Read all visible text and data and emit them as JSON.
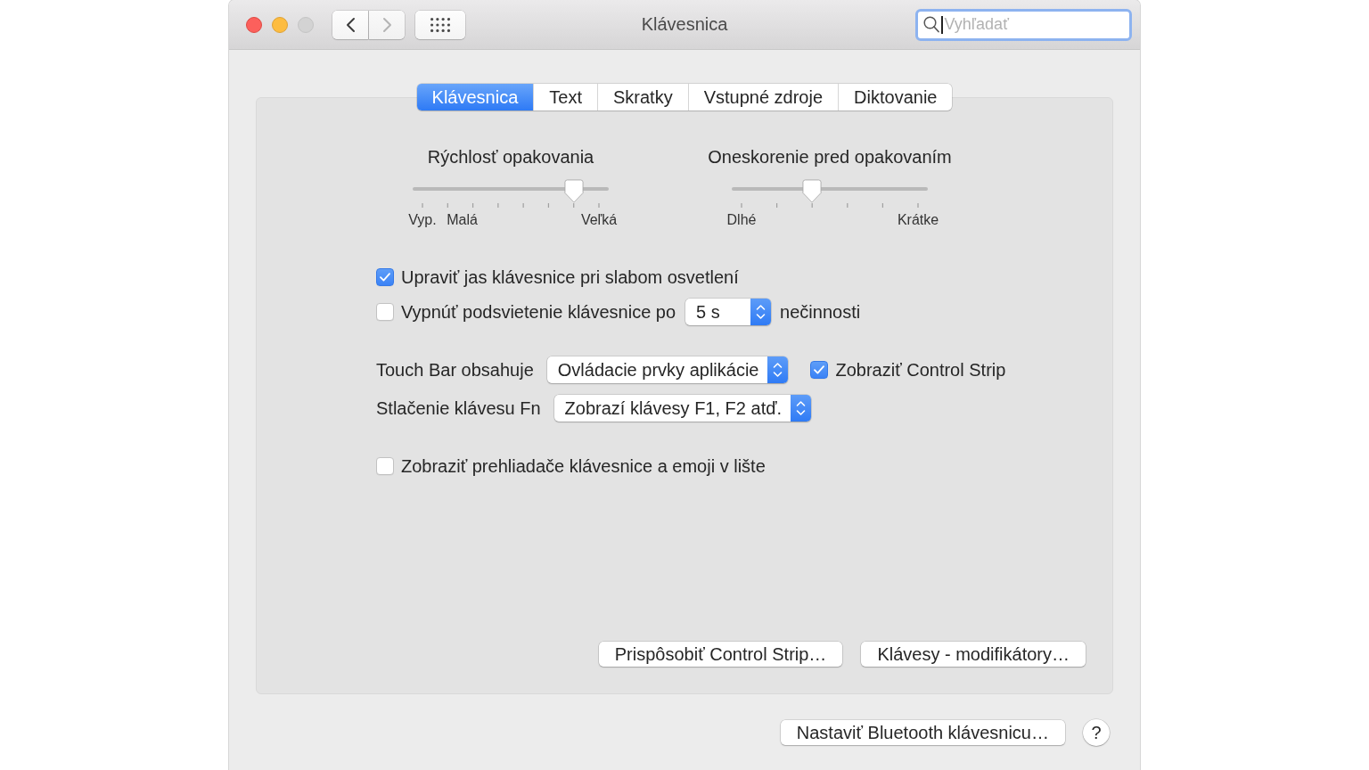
{
  "window": {
    "title": "Klávesnica",
    "buttons": [
      {
        "kind": "close",
        "disabled": false
      },
      {
        "kind": "minimize",
        "disabled": false
      },
      {
        "kind": "zoom",
        "disabled": true
      }
    ]
  },
  "toolbar": {
    "nav_buttons": [
      {
        "kind": "back",
        "disabled": false
      },
      {
        "kind": "forward",
        "disabled": true
      }
    ]
  },
  "search": {
    "placeholder": "Vyhľadať",
    "focused": true
  },
  "tabs": [
    {
      "label": "Klávesnica",
      "selected": true
    },
    {
      "label": "Text",
      "selected": false
    },
    {
      "label": "Skratky",
      "selected": false
    },
    {
      "label": "Vstupné zdroje",
      "selected": false
    },
    {
      "label": "Diktovanie",
      "selected": false
    }
  ],
  "sliders": [
    {
      "kind": "rate",
      "label": "Rýchlosť opakovania",
      "level": 0.857,
      "scale_labels": [
        "Vyp.",
        "Malá",
        "Veľká"
      ]
    },
    {
      "kind": "delay",
      "label": "Oneskorenie pred opakovaním",
      "level": 0.4,
      "scale_labels": [
        "Dlhé",
        "Krátke"
      ]
    }
  ],
  "option_groups": [
    {
      "items": [
        {
          "kind": "checkbox",
          "label": "Upraviť jas klávesnice pri slabom osvetlení",
          "checked": true
        },
        {
          "kind": "checkbox_popup",
          "label": "Vypnúť podsvietenie klávesnice po",
          "checked": false,
          "popup": "5 s",
          "suffix": "nečinnosti"
        }
      ]
    },
    {
      "items": [
        {
          "kind": "popup",
          "label": "Touch Bar obsahuje",
          "popup": "Ovládacie prvky aplikácie",
          "checkbox": {
            "label": "Zobraziť Control Strip",
            "checked": true
          }
        },
        {
          "kind": "popup",
          "label": "Stlačenie klávesu Fn",
          "popup": "Zobrazí klávesy F1, F2 atď."
        }
      ]
    },
    {
      "items": [
        {
          "kind": "checkbox",
          "label": "Zobraziť prehliadače klávesnice a emoji v lište",
          "checked": false
        }
      ]
    }
  ],
  "panel_buttons": [
    "Prispôsobiť Control Strip…",
    "Klávesy - modifikátory…"
  ],
  "footer": {
    "button": "Nastaviť Bluetooth klávesnicu…",
    "help": "?"
  }
}
